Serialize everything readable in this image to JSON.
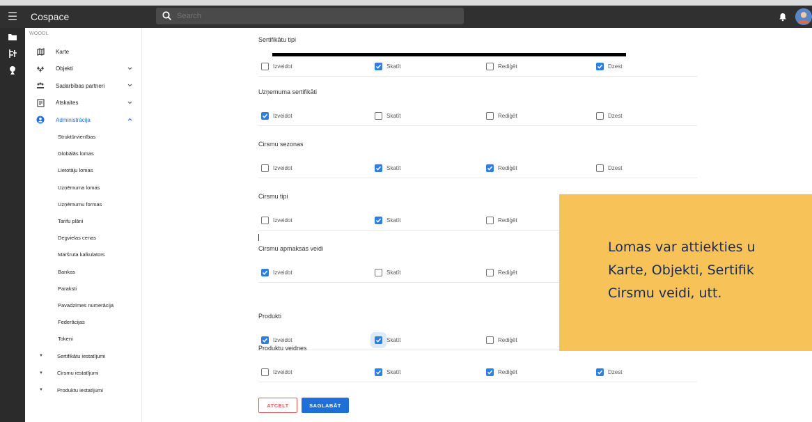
{
  "app": {
    "title": "Cospace"
  },
  "search": {
    "placeholder": "Search"
  },
  "sidebar": {
    "org": "WOODL",
    "nav": [
      {
        "label": "Karte",
        "icon": "map-icon"
      },
      {
        "label": "Objekti",
        "icon": "forest-icon"
      },
      {
        "label": "Sadarbības partneri",
        "icon": "partners-icon"
      },
      {
        "label": "Atskaites",
        "icon": "report-icon"
      },
      {
        "label": "Administrācija",
        "icon": "admin-icon"
      }
    ],
    "sub": [
      "Struktūrvienības",
      "Globālās lomas",
      "Lietotāju lomas",
      "Uzņēmuma lomas",
      "Uzņēmumu formas",
      "Tarifu plāni",
      "Degvielas cenas",
      "Maršruta kalkulators",
      "Bankas",
      "Paraksti",
      "Pavadzīmes numerācija",
      "Federācijas",
      "Tokeni"
    ],
    "groups": [
      "Sertifikātu iestatījumi",
      "Cirsmu iestatījumi",
      "Produktu iestatījumi"
    ]
  },
  "permissions": {
    "labels": {
      "create": "Izveidot",
      "view": "Skatīt",
      "edit": "Rediģēt",
      "delete": "Dzest"
    },
    "sections": [
      {
        "title": "Sertifikātu tipi",
        "create": false,
        "view": true,
        "edit": false,
        "delete": true
      },
      {
        "title": "Uzņemuma sertifikāti",
        "create": true,
        "view": false,
        "edit": false,
        "delete": false
      },
      {
        "title": "Cirsmu sezonas",
        "create": false,
        "view": true,
        "edit": true,
        "delete": false
      },
      {
        "title": "Cirsmu tipi",
        "create": false,
        "view": true,
        "edit": false
      },
      {
        "title": "Cirsmu apmaksas veidi",
        "create": true,
        "view": false,
        "edit": false
      },
      {
        "title": "Produkti",
        "create": true,
        "view": true,
        "edit": false
      },
      {
        "title": "Produktu veidnes",
        "create": false,
        "view": true,
        "edit": true,
        "delete": true
      }
    ]
  },
  "actions": {
    "cancel": "ATCELT",
    "save": "SAGLABĀT"
  },
  "note": {
    "line1": "Lomas var attiekties u",
    "line2": "Karte, Objekti, Sertifik",
    "line3": "Cirsmu veidi, utt."
  },
  "colors": {
    "accent": "#2f7fe0",
    "topbar": "#303030",
    "note": "#f7c358",
    "cancel": "#e05a5a"
  }
}
